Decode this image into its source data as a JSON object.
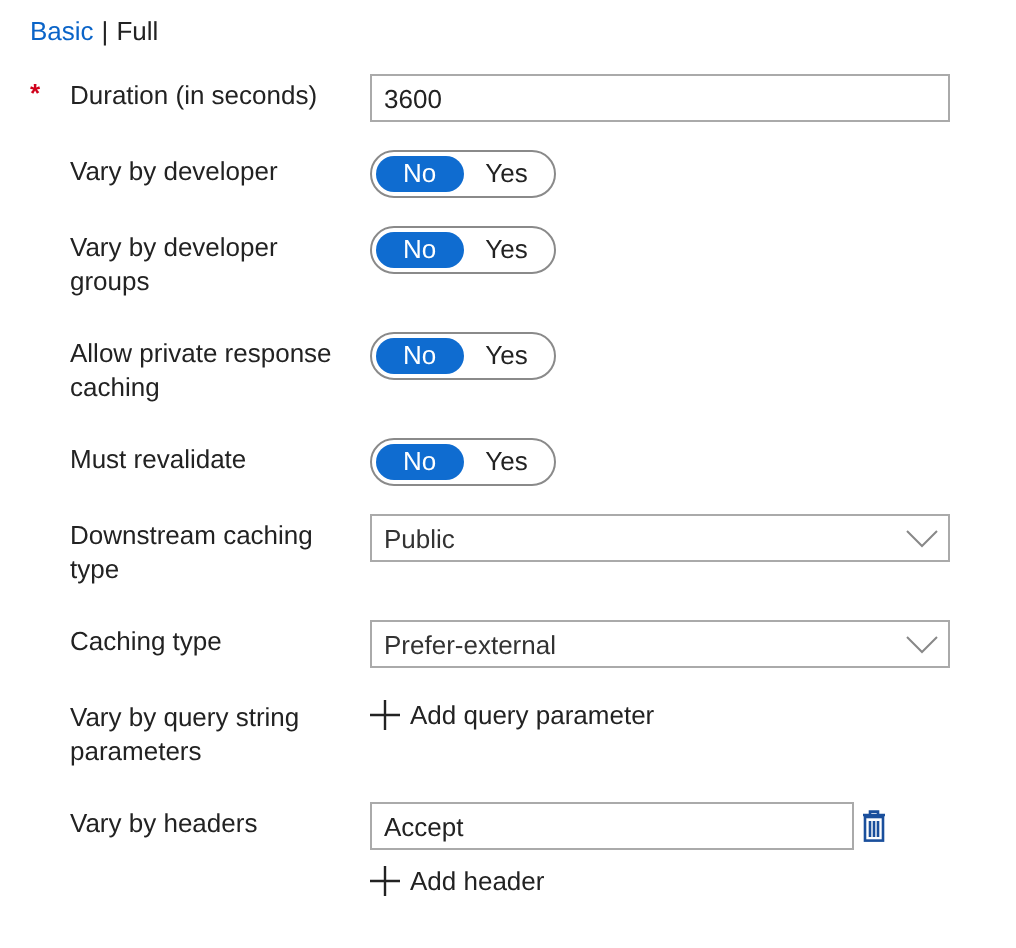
{
  "modes": [
    {
      "label": "Basic",
      "selected": false
    },
    {
      "label": "Full",
      "selected": true
    }
  ],
  "mode_separator": "|",
  "required_mark": "*",
  "fields": [
    {
      "kind": "text",
      "label": "Duration (in seconds)",
      "required": true,
      "value": "3600"
    },
    {
      "kind": "toggle",
      "label": "Vary by developer",
      "required": false,
      "options": [
        {
          "label": "No",
          "selected": true
        },
        {
          "label": "Yes",
          "selected": false
        }
      ]
    },
    {
      "kind": "toggle",
      "label": "Vary by developer groups",
      "required": false,
      "options": [
        {
          "label": "No",
          "selected": true
        },
        {
          "label": "Yes",
          "selected": false
        }
      ]
    },
    {
      "kind": "toggle",
      "label": "Allow private response caching",
      "required": false,
      "options": [
        {
          "label": "No",
          "selected": true
        },
        {
          "label": "Yes",
          "selected": false
        }
      ]
    },
    {
      "kind": "toggle",
      "label": "Must revalidate",
      "required": false,
      "options": [
        {
          "label": "No",
          "selected": true
        },
        {
          "label": "Yes",
          "selected": false
        }
      ]
    },
    {
      "kind": "select",
      "label": "Downstream caching type",
      "required": false,
      "value": "Public"
    },
    {
      "kind": "select",
      "label": "Caching type",
      "required": false,
      "value": "Prefer-external"
    },
    {
      "kind": "add",
      "label": "Vary by query string parameters",
      "required": false,
      "add_label": "Add query parameter"
    },
    {
      "kind": "list",
      "label": "Vary by headers",
      "required": false,
      "items": [
        "Accept"
      ],
      "add_label": "Add header"
    }
  ]
}
